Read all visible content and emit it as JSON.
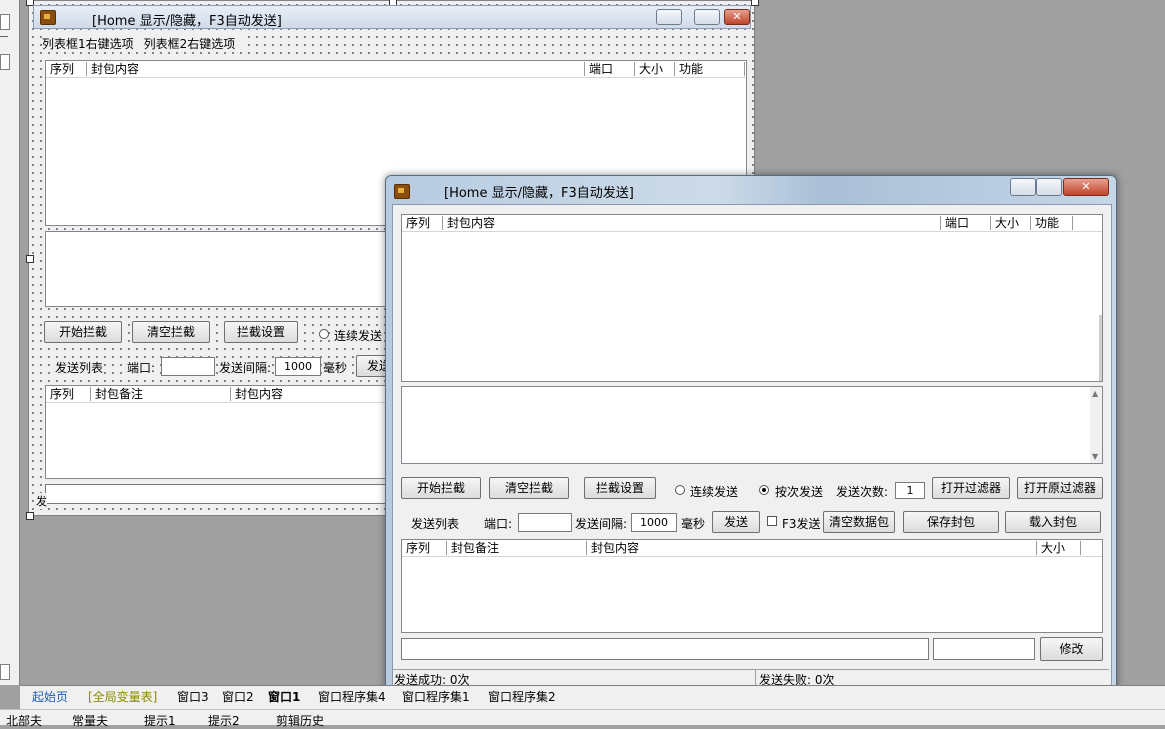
{
  "design_window": {
    "title": "[Home 显示/隐藏，F3自动发送]",
    "menu": [
      "列表框1右键选项",
      "列表框2右键选项"
    ],
    "list1_columns": [
      "序列",
      "封包内容",
      "端口",
      "大小",
      "功能"
    ],
    "buttons": {
      "start": "开始拦截",
      "clear": "清空拦截",
      "settings": "拦截设置"
    },
    "radio_continuous": "连续发送",
    "send_list_label": "发送列表",
    "port_label": "端口:",
    "interval_label": "发送间隔:",
    "interval_value": "1000",
    "ms_label": "毫秒",
    "send_partial": "发送",
    "list2_columns": [
      "序列",
      "封包备注",
      "封包内容"
    ],
    "status_partial": "发"
  },
  "main_window": {
    "title": "[Home 显示/隐藏，F3自动发送]",
    "list1_columns": [
      "序列",
      "封包内容",
      "端口",
      "大小",
      "功能"
    ],
    "buttons": {
      "start": "开始拦截",
      "clear": "清空拦截",
      "settings": "拦截设置",
      "open_filter": "打开过滤器",
      "open_raw_filter": "打开原过滤器",
      "send": "发送",
      "clear_data": "清空数据包",
      "save": "保存封包",
      "load": "载入封包",
      "modify": "修改"
    },
    "radio_continuous": "连续发送",
    "radio_count": "按次发送",
    "send_count_label": "发送次数:",
    "send_count_value": "1",
    "send_list_label": "发送列表",
    "port_label": "端口:",
    "port_value": "",
    "interval_label": "发送间隔:",
    "interval_value": "1000",
    "ms_label": "毫秒",
    "f3_label": "F3发送",
    "list2_columns": [
      "序列",
      "封包备注",
      "封包内容",
      "大小"
    ],
    "status_success": "发送成功: 0次",
    "status_fail": "发送失败: 0次"
  },
  "tabs": [
    "起始页",
    "[全局变量表]",
    "窗口3",
    "窗口2",
    "窗口1",
    "窗口程序集4",
    "窗口程序集1",
    "窗口程序集2"
  ],
  "bottom_bar": [
    "北部夫",
    "常量夫",
    "提示1",
    "提示2",
    "剪辑历史"
  ],
  "colors": {
    "tab_start": "#1a5fb4",
    "tab_global": "#8a8a00",
    "accent_close": "#c0442a"
  }
}
